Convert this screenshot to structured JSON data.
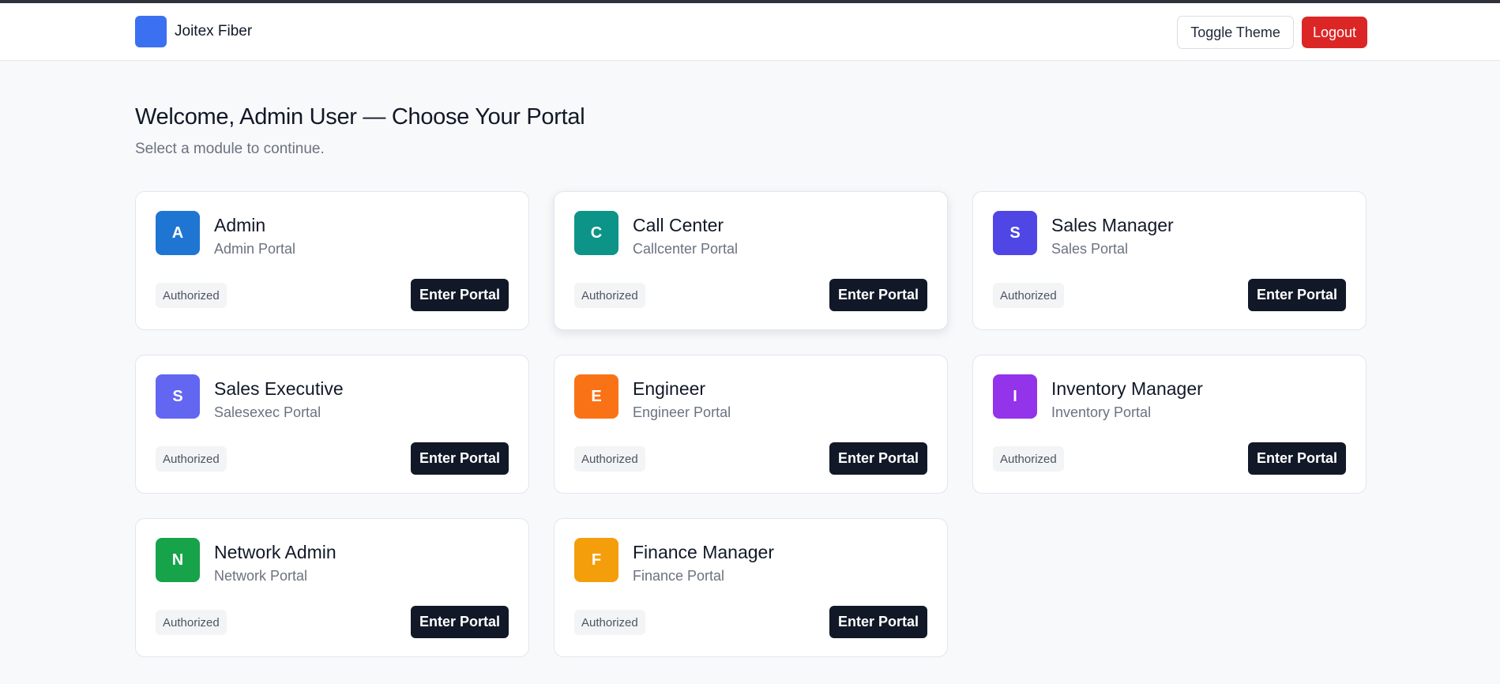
{
  "header": {
    "brand_name": "Joitex Fiber",
    "brand_color": "#3b71f0",
    "toggle_theme_label": "Toggle Theme",
    "logout_label": "Logout"
  },
  "main": {
    "title": "Welcome, Admin User — Choose Your Portal",
    "subtitle": "Select a module to continue."
  },
  "portals": [
    {
      "initial": "A",
      "title": "Admin",
      "subtitle": "Admin Portal",
      "badge": "Authorized",
      "button": "Enter Portal",
      "color": "#1f76d2"
    },
    {
      "initial": "C",
      "title": "Call Center",
      "subtitle": "Callcenter Portal",
      "badge": "Authorized",
      "button": "Enter Portal",
      "color": "#0d9488"
    },
    {
      "initial": "S",
      "title": "Sales Manager",
      "subtitle": "Sales Portal",
      "badge": "Authorized",
      "button": "Enter Portal",
      "color": "#4f46e5"
    },
    {
      "initial": "S",
      "title": "Sales Executive",
      "subtitle": "Salesexec Portal",
      "badge": "Authorized",
      "button": "Enter Portal",
      "color": "#6366f1"
    },
    {
      "initial": "E",
      "title": "Engineer",
      "subtitle": "Engineer Portal",
      "badge": "Authorized",
      "button": "Enter Portal",
      "color": "#f97316"
    },
    {
      "initial": "I",
      "title": "Inventory Manager",
      "subtitle": "Inventory Portal",
      "badge": "Authorized",
      "button": "Enter Portal",
      "color": "#9333ea"
    },
    {
      "initial": "N",
      "title": "Network Admin",
      "subtitle": "Network Portal",
      "badge": "Authorized",
      "button": "Enter Portal",
      "color": "#16a34a"
    },
    {
      "initial": "F",
      "title": "Finance Manager",
      "subtitle": "Finance Portal",
      "badge": "Authorized",
      "button": "Enter Portal",
      "color": "#f59e0b"
    }
  ],
  "colors": {
    "logout": "#dc2626",
    "enter_button": "#111827",
    "background": "#f8f9fb"
  }
}
